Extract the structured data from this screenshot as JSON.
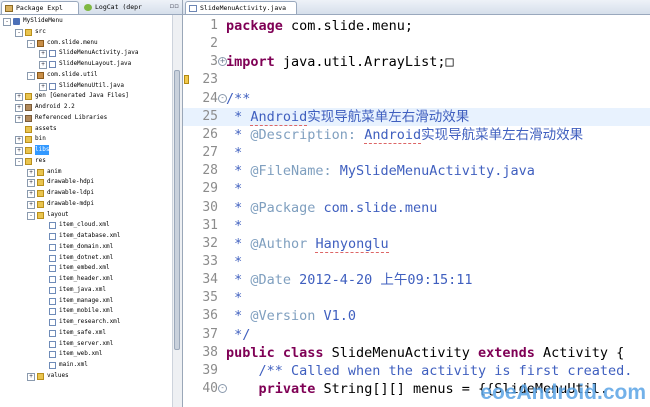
{
  "left_panel": {
    "tabs": [
      {
        "label": "Package Expl",
        "active": true
      },
      {
        "label": "LogCat (depr",
        "active": false
      }
    ],
    "tree": [
      {
        "label": "MySlideMenu",
        "level": 0,
        "expander": "-",
        "icon": "project-icon"
      },
      {
        "label": "src",
        "level": 1,
        "expander": "-",
        "icon": "folder-icon"
      },
      {
        "label": "com.slide.menu",
        "level": 2,
        "expander": "-",
        "icon": "package-icon"
      },
      {
        "label": "SlideMenuActivity.java",
        "level": 3,
        "expander": "+",
        "icon": "java-file-icon"
      },
      {
        "label": "SlideMenuLayout.java",
        "level": 3,
        "expander": "+",
        "icon": "java-file-icon"
      },
      {
        "label": "com.slide.util",
        "level": 2,
        "expander": "-",
        "icon": "package-icon"
      },
      {
        "label": "SlideMenuUtil.java",
        "level": 3,
        "expander": "+",
        "icon": "java-file-icon"
      },
      {
        "label": "gen [Generated Java Files]",
        "level": 1,
        "expander": "+",
        "icon": "folder-icon"
      },
      {
        "label": "Android 2.2",
        "level": 1,
        "expander": "+",
        "icon": "library-icon"
      },
      {
        "label": "Referenced Libraries",
        "level": 1,
        "expander": "+",
        "icon": "library-icon"
      },
      {
        "label": "assets",
        "level": 1,
        "expander": "",
        "icon": "folder-icon"
      },
      {
        "label": "bin",
        "level": 1,
        "expander": "+",
        "icon": "folder-icon"
      },
      {
        "label": "libs",
        "level": 1,
        "expander": "+",
        "icon": "folder-icon",
        "selected": true
      },
      {
        "label": "res",
        "level": 1,
        "expander": "-",
        "icon": "folder-icon"
      },
      {
        "label": "anim",
        "level": 2,
        "expander": "+",
        "icon": "folder-icon"
      },
      {
        "label": "drawable-hdpi",
        "level": 2,
        "expander": "+",
        "icon": "folder-icon"
      },
      {
        "label": "drawable-ldpi",
        "level": 2,
        "expander": "+",
        "icon": "folder-icon"
      },
      {
        "label": "drawable-mdpi",
        "level": 2,
        "expander": "+",
        "icon": "folder-icon"
      },
      {
        "label": "layout",
        "level": 2,
        "expander": "-",
        "icon": "folder-icon"
      },
      {
        "label": "item_cloud.xml",
        "level": 3,
        "expander": "",
        "icon": "xml-file-icon"
      },
      {
        "label": "item_database.xml",
        "level": 3,
        "expander": "",
        "icon": "xml-file-icon"
      },
      {
        "label": "item_domain.xml",
        "level": 3,
        "expander": "",
        "icon": "xml-file-icon"
      },
      {
        "label": "item_dotnet.xml",
        "level": 3,
        "expander": "",
        "icon": "xml-file-icon"
      },
      {
        "label": "item_embed.xml",
        "level": 3,
        "expander": "",
        "icon": "xml-file-icon"
      },
      {
        "label": "item_header.xml",
        "level": 3,
        "expander": "",
        "icon": "xml-file-icon"
      },
      {
        "label": "item_java.xml",
        "level": 3,
        "expander": "",
        "icon": "xml-file-icon"
      },
      {
        "label": "item_manage.xml",
        "level": 3,
        "expander": "",
        "icon": "xml-file-icon"
      },
      {
        "label": "item_mobile.xml",
        "level": 3,
        "expander": "",
        "icon": "xml-file-icon"
      },
      {
        "label": "item_research.xml",
        "level": 3,
        "expander": "",
        "icon": "xml-file-icon"
      },
      {
        "label": "item_safe.xml",
        "level": 3,
        "expander": "",
        "icon": "xml-file-icon"
      },
      {
        "label": "item_server.xml",
        "level": 3,
        "expander": "",
        "icon": "xml-file-icon"
      },
      {
        "label": "item_web.xml",
        "level": 3,
        "expander": "",
        "icon": "xml-file-icon"
      },
      {
        "label": "main.xml",
        "level": 3,
        "expander": "",
        "icon": "xml-file-icon"
      },
      {
        "label": "values",
        "level": 2,
        "expander": "+",
        "icon": "folder-icon"
      }
    ]
  },
  "editor": {
    "tab_label": "SlideMenuActivity.java",
    "lines": [
      {
        "num": "1",
        "fold": "",
        "segments": [
          {
            "t": "package",
            "c": "kw"
          },
          {
            "t": " com.slide.menu;",
            "c": ""
          }
        ]
      },
      {
        "num": "2",
        "fold": "",
        "segments": []
      },
      {
        "num": "3",
        "fold": "+",
        "segments": [
          {
            "t": "import",
            "c": "kw"
          },
          {
            "t": " java.util.ArrayList;",
            "c": ""
          },
          {
            "t": "□",
            "c": ""
          }
        ]
      },
      {
        "num": "23",
        "fold": "",
        "segments": []
      },
      {
        "num": "24",
        "fold": "-",
        "segments": [
          {
            "t": "/**",
            "c": "cm"
          }
        ]
      },
      {
        "num": "25",
        "fold": "",
        "hl": true,
        "segments": [
          {
            "t": " * ",
            "c": "cm"
          },
          {
            "t": "Android",
            "c": "cm ul"
          },
          {
            "t": "实现导航菜单左右滑动效果",
            "c": "cm"
          }
        ]
      },
      {
        "num": "26",
        "fold": "",
        "segments": [
          {
            "t": " * ",
            "c": "cm"
          },
          {
            "t": "@Description:",
            "c": "tg"
          },
          {
            "t": " ",
            "c": "cm"
          },
          {
            "t": "Android",
            "c": "cm ul"
          },
          {
            "t": "实现导航菜单左右滑动效果",
            "c": "cm"
          }
        ]
      },
      {
        "num": "27",
        "fold": "",
        "segments": [
          {
            "t": " *",
            "c": "cm"
          }
        ]
      },
      {
        "num": "28",
        "fold": "",
        "segments": [
          {
            "t": " * ",
            "c": "cm"
          },
          {
            "t": "@FileName:",
            "c": "tg"
          },
          {
            "t": " MySlideMenuActivity.java",
            "c": "cm"
          }
        ]
      },
      {
        "num": "29",
        "fold": "",
        "segments": [
          {
            "t": " *",
            "c": "cm"
          }
        ]
      },
      {
        "num": "30",
        "fold": "",
        "segments": [
          {
            "t": " * ",
            "c": "cm"
          },
          {
            "t": "@Package",
            "c": "tg"
          },
          {
            "t": " com.slide.menu",
            "c": "cm"
          }
        ]
      },
      {
        "num": "31",
        "fold": "",
        "segments": [
          {
            "t": " *",
            "c": "cm"
          }
        ]
      },
      {
        "num": "32",
        "fold": "",
        "segments": [
          {
            "t": " * ",
            "c": "cm"
          },
          {
            "t": "@Author",
            "c": "tg"
          },
          {
            "t": " ",
            "c": "cm"
          },
          {
            "t": "Hanyonglu",
            "c": "cm ul"
          }
        ]
      },
      {
        "num": "33",
        "fold": "",
        "segments": [
          {
            "t": " *",
            "c": "cm"
          }
        ]
      },
      {
        "num": "34",
        "fold": "",
        "segments": [
          {
            "t": " * ",
            "c": "cm"
          },
          {
            "t": "@Date",
            "c": "tg"
          },
          {
            "t": " 2012-4-20 上午09:15:11",
            "c": "cm"
          }
        ]
      },
      {
        "num": "35",
        "fold": "",
        "segments": [
          {
            "t": " *",
            "c": "cm"
          }
        ]
      },
      {
        "num": "36",
        "fold": "",
        "segments": [
          {
            "t": " * ",
            "c": "cm"
          },
          {
            "t": "@Version",
            "c": "tg"
          },
          {
            "t": " V1.0",
            "c": "cm"
          }
        ]
      },
      {
        "num": "37",
        "fold": "",
        "segments": [
          {
            "t": " */",
            "c": "cm"
          }
        ]
      },
      {
        "num": "38",
        "fold": "",
        "segments": [
          {
            "t": "public class",
            "c": "kw"
          },
          {
            "t": " SlideMenuActivity ",
            "c": ""
          },
          {
            "t": "extends",
            "c": "kw"
          },
          {
            "t": " Activity {",
            "c": ""
          }
        ]
      },
      {
        "num": "39",
        "fold": "",
        "segments": [
          {
            "t": "    /** Called when the activity is first created.",
            "c": "cm"
          }
        ]
      },
      {
        "num": "40",
        "fold": "-",
        "segments": [
          {
            "t": "    ",
            "c": ""
          },
          {
            "t": "private",
            "c": "kw"
          },
          {
            "t": " String[][] menus = {{SlideMenuUtil.",
            "c": ""
          }
        ]
      }
    ]
  },
  "watermark": "eoeAndroid.com"
}
